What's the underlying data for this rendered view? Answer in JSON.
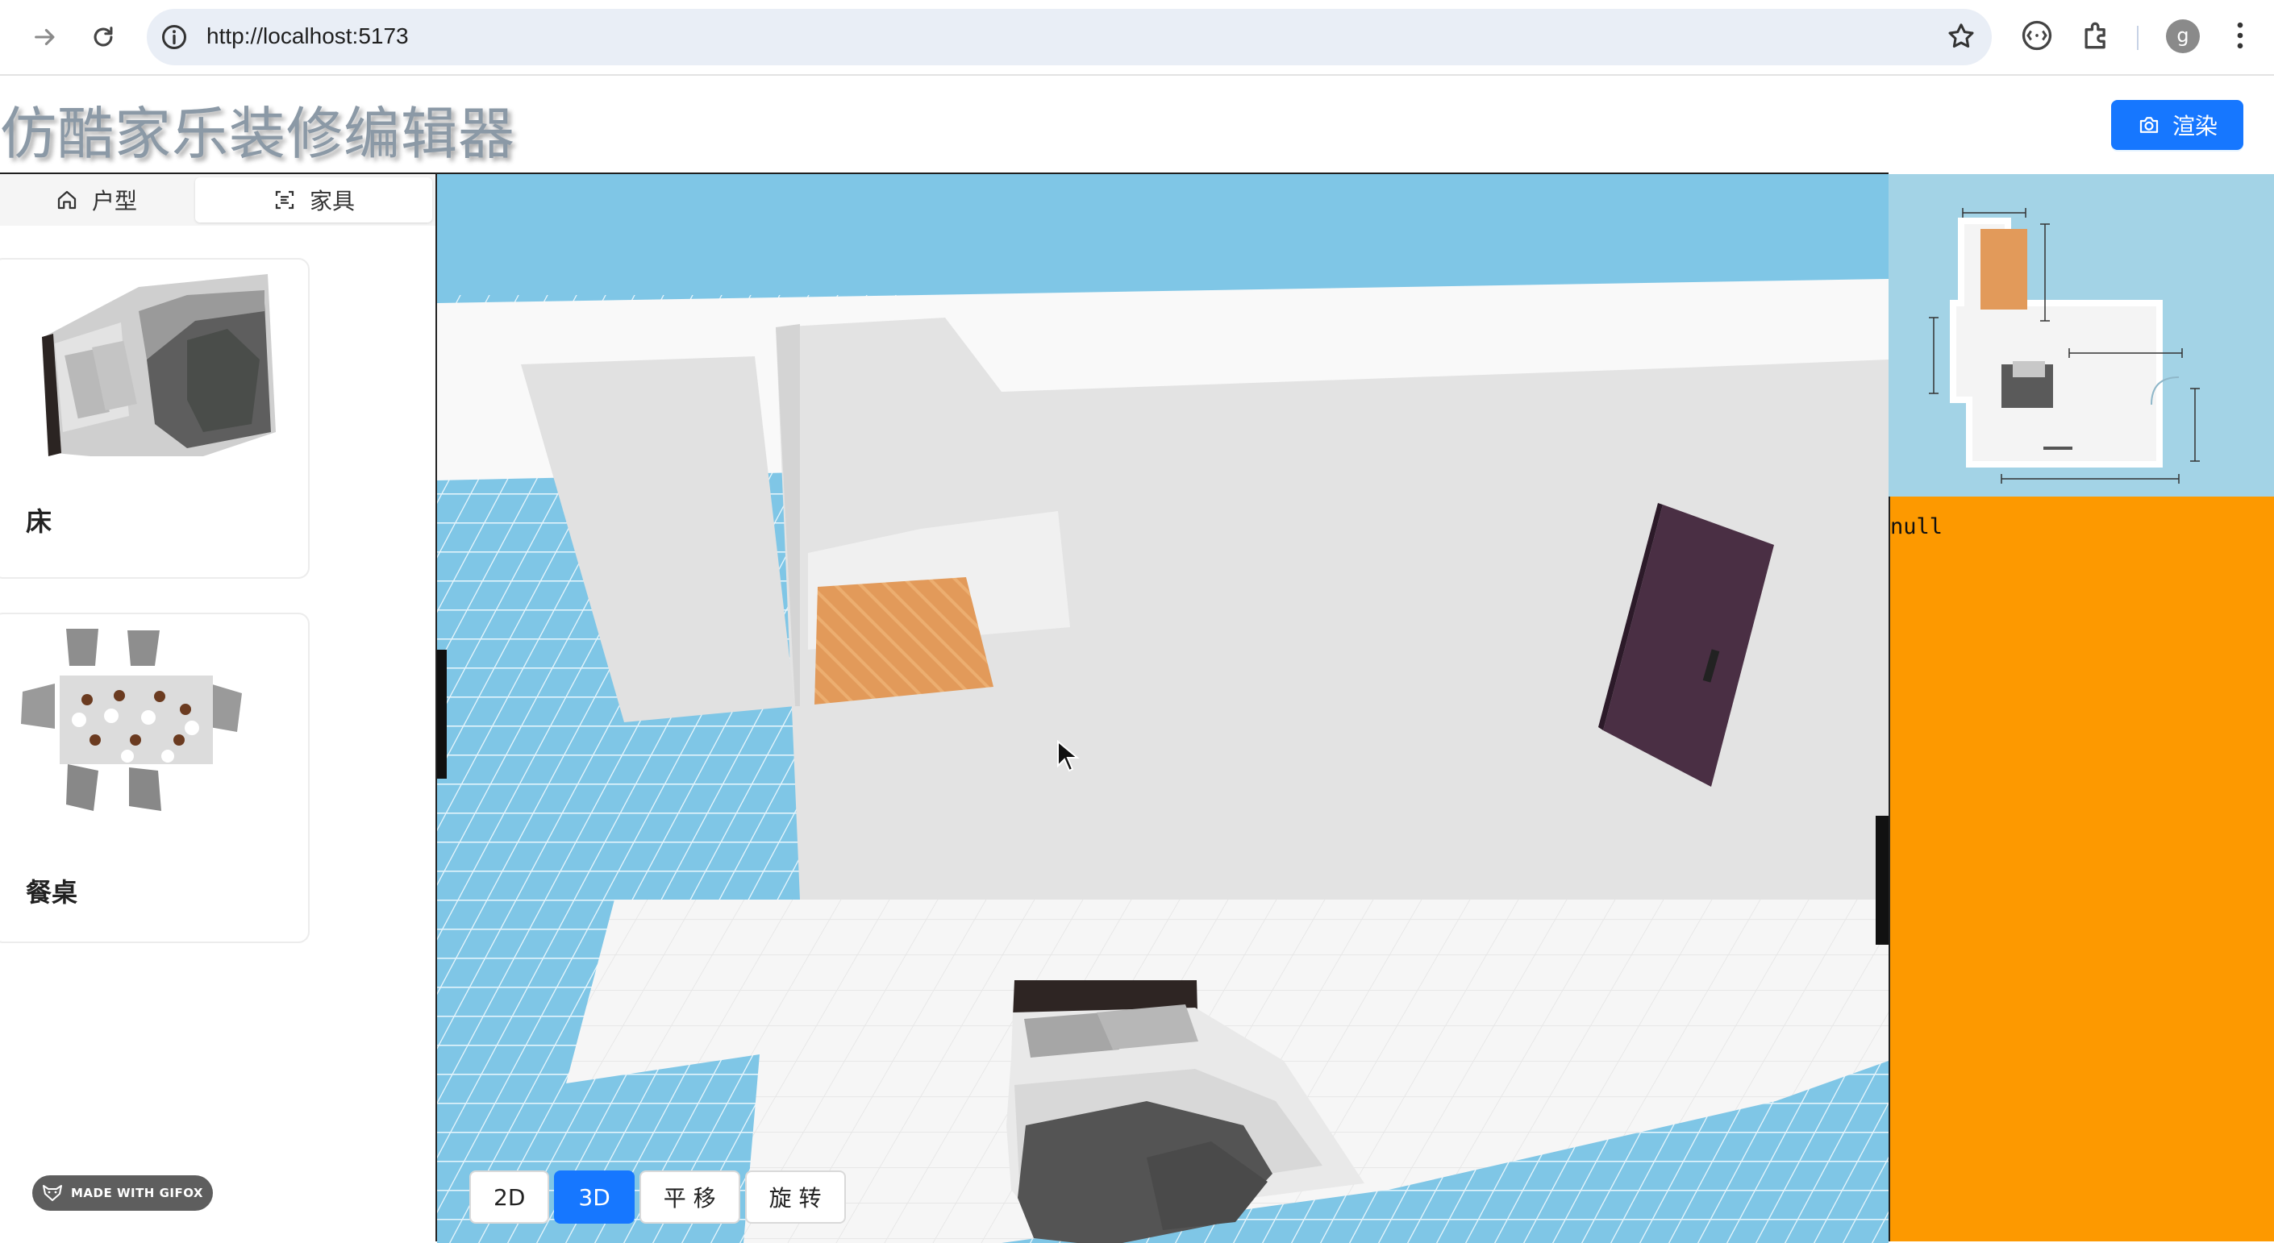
{
  "browser": {
    "url": "http://localhost:5173",
    "avatar_letter": "g"
  },
  "app": {
    "title": "仿酷家乐装修编辑器",
    "render_button": "渲染"
  },
  "left_panel": {
    "tabs": [
      {
        "label": "户型",
        "icon": "home-icon"
      },
      {
        "label": "家具",
        "icon": "scan-icon"
      }
    ],
    "active_tab": "家具",
    "furniture": [
      {
        "label": "床"
      },
      {
        "label": "餐桌"
      }
    ]
  },
  "viewport": {
    "modes": [
      "2D",
      "3D",
      "平 移",
      "旋 转"
    ],
    "active_mode": "3D"
  },
  "info_panel": {
    "text": "null"
  },
  "watermark": "MADE WITH GIFOX",
  "colors": {
    "accent": "#1677ff",
    "info_panel": "#fd9900",
    "sky": "#7fc6e6",
    "door": "#4a2f44",
    "floor_tile": "#e29a5a"
  }
}
